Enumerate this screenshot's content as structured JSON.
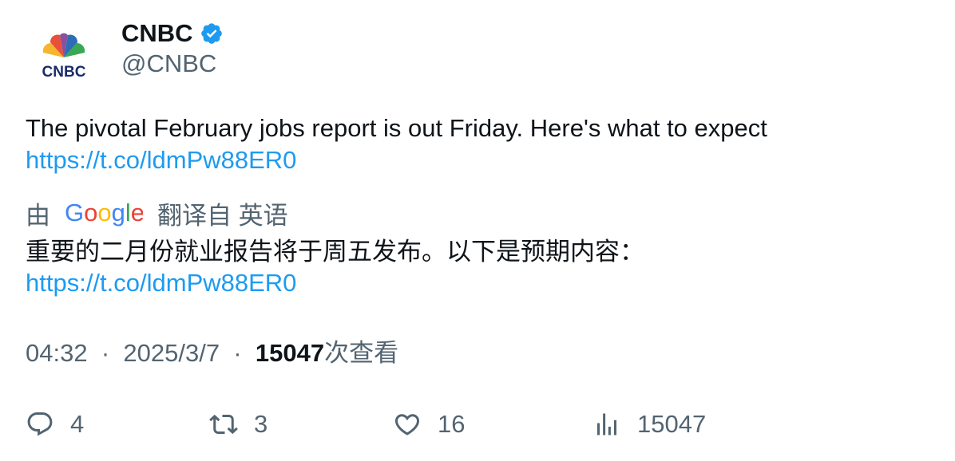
{
  "author": {
    "display_name": "CNBC",
    "handle": "@CNBC",
    "verified": true,
    "avatar_icon": "cnbc-peacock-logo",
    "avatar_text": "CNBC"
  },
  "tweet": {
    "text": "The pivotal February jobs report is out Friday. Here's what to expect",
    "link": "https://t.co/ldmPw88ER0"
  },
  "translation": {
    "prefix": "由",
    "provider": "Google",
    "suffix": "翻译自 英语",
    "text": "重要的二月份就业报告将于周五发布。以下是预期内容：",
    "link": "https://t.co/ldmPw88ER0"
  },
  "meta": {
    "time": "04:32",
    "separator": "·",
    "date": "2025/3/7",
    "views_count": "15047",
    "views_label": "次查看"
  },
  "actions": {
    "reply_count": "4",
    "retweet_count": "3",
    "like_count": "16",
    "views_count": "15047"
  },
  "colors": {
    "text": "#0f1419",
    "secondary": "#536471",
    "link": "#1d9bf0",
    "verified": "#1d9bf0"
  }
}
